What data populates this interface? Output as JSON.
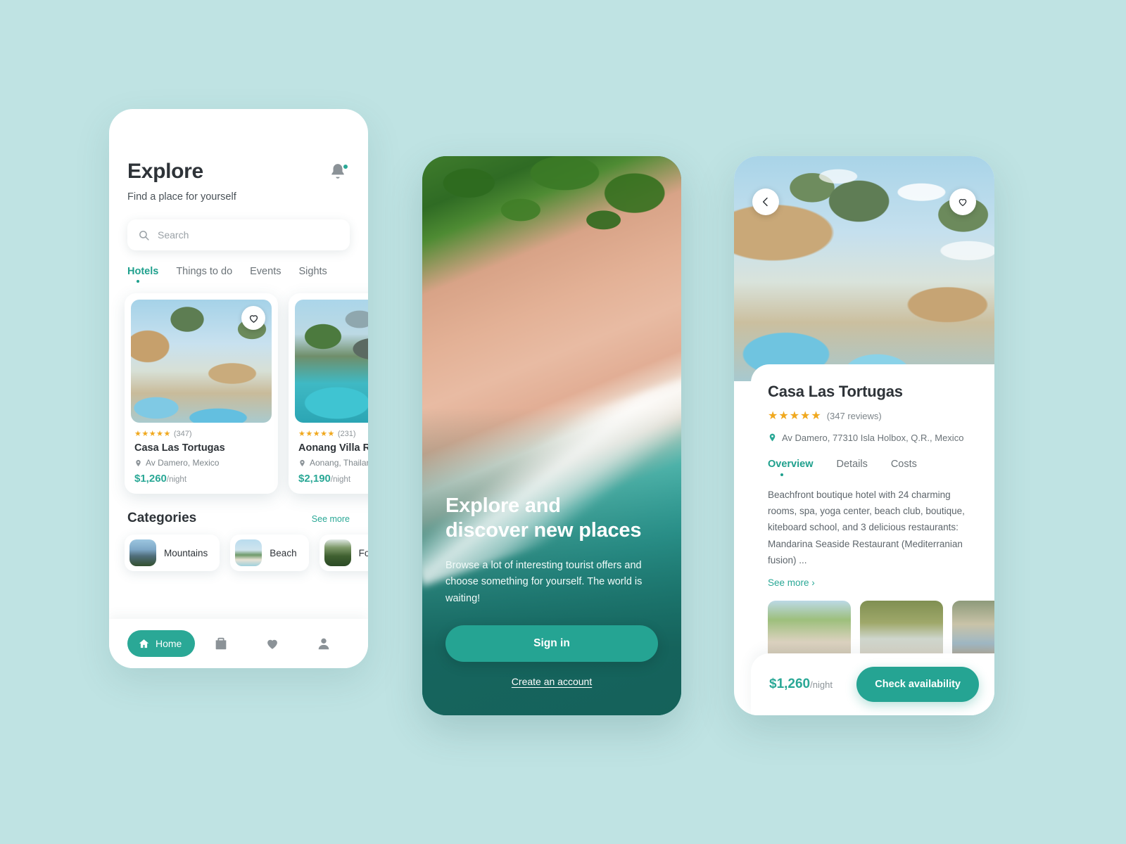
{
  "theme": {
    "background": "#bfe3e3",
    "accent": "#2aa896",
    "star": "#f0a81e",
    "text": "#2e3338"
  },
  "explore_screen": {
    "title": "Explore",
    "subtitle": "Find a place for yourself",
    "bell_icon": "notification-bell-icon",
    "search": {
      "placeholder": "Search",
      "icon": "search-icon"
    },
    "tabs": [
      {
        "label": "Hotels",
        "active": true
      },
      {
        "label": "Things to do",
        "active": false
      },
      {
        "label": "Events",
        "active": false
      },
      {
        "label": "Sights",
        "active": false
      }
    ],
    "hotel_cards": [
      {
        "stars": "★★★★★",
        "reviews": "(347)",
        "name": "Casa Las Tortugas",
        "location": "Av Damero, Mexico",
        "price": "$1,260",
        "per": "/night"
      },
      {
        "stars": "★★★★★",
        "reviews": "(231)",
        "name": "Aonang Villa Resort",
        "location": "Aonang, Thailand",
        "price": "$2,190",
        "per": "/night"
      }
    ],
    "categories_title": "Categories",
    "categories_see_more": "See more",
    "categories": [
      {
        "label": "Mountains"
      },
      {
        "label": "Beach"
      },
      {
        "label": "Forest"
      }
    ],
    "nav": [
      {
        "label": "Home",
        "icon": "home-icon",
        "active": true
      },
      {
        "label": "Trips",
        "icon": "briefcase-icon",
        "active": false
      },
      {
        "label": "Favorites",
        "icon": "heart-icon",
        "active": false
      },
      {
        "label": "Profile",
        "icon": "person-icon",
        "active": false
      }
    ]
  },
  "onboarding_screen": {
    "heading_line1": "Explore and",
    "heading_line2": "discover new places",
    "paragraph": "Browse a lot of interesting tourist offers and choose something for yourself. The world is waiting!",
    "sign_in_label": "Sign in",
    "create_account_label": "Create an account"
  },
  "detail_screen": {
    "back_icon": "chevron-left-icon",
    "favorite_icon": "heart-outline-icon",
    "title": "Casa Las Tortugas",
    "stars": "★★★★★",
    "reviews": "(347 reviews)",
    "address": "Av Damero, 77310 Isla Holbox, Q.R., Mexico",
    "tabs": [
      {
        "label": "Overview",
        "active": true
      },
      {
        "label": "Details",
        "active": false
      },
      {
        "label": "Costs",
        "active": false
      }
    ],
    "description": "Beachfront boutique hotel with 24 charming rooms, spa, yoga center, beach club, boutique, kiteboard school, and 3 delicious restaurants: Mandarina Seaside Restaurant (Mediterranian fusion) ...",
    "see_more": "See more ›",
    "price": "$1,260",
    "per": "/night",
    "check_label": "Check availability"
  }
}
